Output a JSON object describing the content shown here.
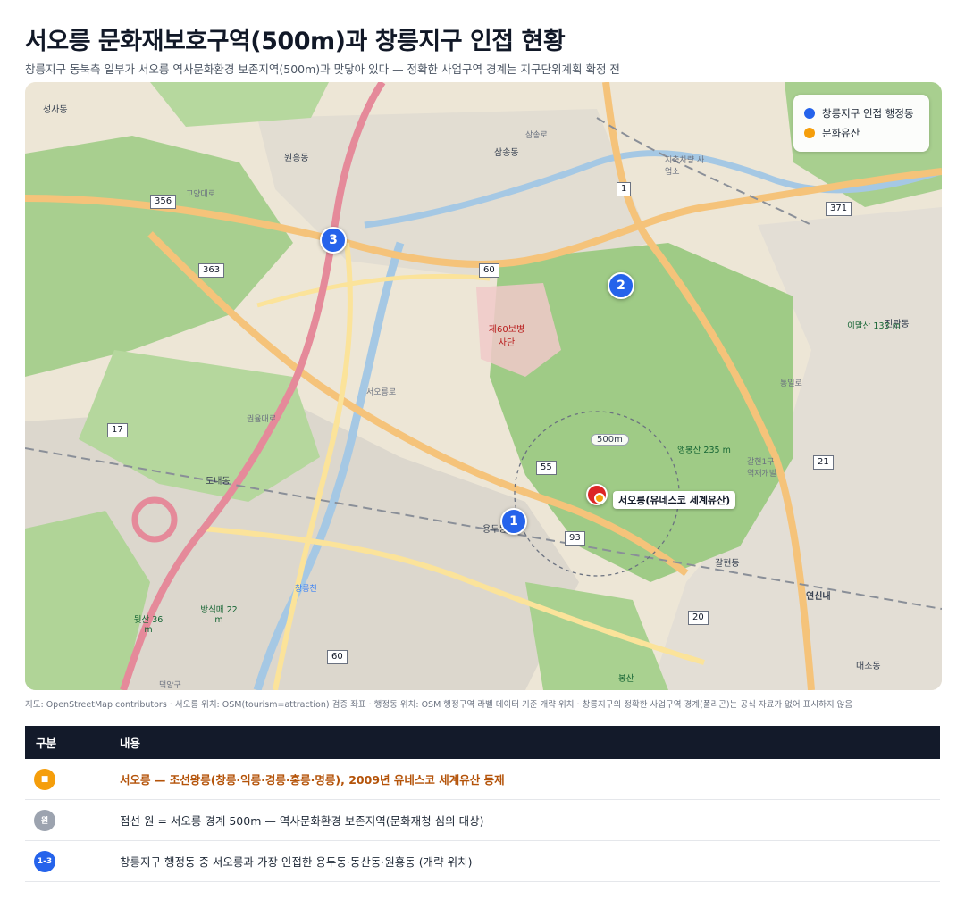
{
  "header": {
    "title": "서오릉 문화재보호구역(500m)과 창릉지구 인접 현황",
    "subtitle": "창릉지구 동북측 일부가 서오릉 역사문화환경 보존지역(500m)과 맞닿아 있다 — 정확한 사업구역 경계는 지구단위계획 확정 전"
  },
  "map": {
    "legend": [
      {
        "label": "창릉지구 인접 행정동",
        "color": "#2563eb"
      },
      {
        "label": "문화유산",
        "color": "#f59e0b"
      }
    ],
    "pins": [
      {
        "label": "1"
      },
      {
        "label": "2"
      },
      {
        "label": "3"
      }
    ],
    "site": {
      "label": "서오릉(유네스코 세계유산)",
      "color": "#dc2626",
      "dot_color": "#f59e0b"
    },
    "ring_label": "500m",
    "place_names": [
      "성사동",
      "삼송동",
      "원흥동",
      "용두동",
      "도내동",
      "갈현동",
      "진관동",
      "대조동",
      "연신내",
      "제60보병 사단",
      "앵봉산 235 m",
      "이말산 133 m",
      "봉산",
      "덕양구",
      "창릉천",
      "서오릉로",
      "통일로",
      "고양대로",
      "삼송로",
      "권율대로",
      "갈현1구 역재개발",
      "지축차량 사업소",
      "방식매 22 m",
      "뒷산 36 m"
    ],
    "road_shields": [
      "356",
      "363",
      "60",
      "55",
      "93",
      "20",
      "17",
      "1",
      "21",
      "371",
      "60"
    ]
  },
  "attribution": "지도: OpenStreetMap contributors · 서오릉 위치: OSM(tourism=attraction) 검증 좌표 · 행정동 위치: OSM 행정구역 라벨 데이터 기준 개략 위치 · 창릉지구의 정확한 사업구역 경계(폴리곤)는 공식 자료가 없어 표시하지 않음",
  "table": {
    "headers": [
      "구분",
      "내용"
    ],
    "rows": [
      {
        "badge": "■",
        "badge_color": "#f59e0b",
        "text": "서오릉 — 조선왕릉(창릉·익릉·경릉·홍릉·명릉), 2009년 유네스코 세계유산 등재",
        "accent": true
      },
      {
        "badge": "원",
        "badge_color": "#9ca3af",
        "text": "점선 원 = 서오릉 경계 500m — 역사문화환경 보존지역(문화재청 심의 대상)",
        "accent": false
      },
      {
        "badge": "1-3",
        "badge_color": "#2563eb",
        "text": "창릉지구 행정동 중 서오릉과 가장 인접한 용두동·동산동·원흥동 (개략 위치)",
        "accent": false
      }
    ]
  }
}
